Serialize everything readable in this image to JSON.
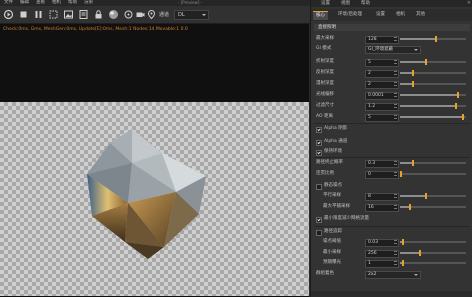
{
  "menu": {
    "items": [
      "文件",
      "编辑",
      "查看",
      "相机",
      "帮助",
      "渲染"
    ],
    "window_title": "- [Preview] -"
  },
  "toolbar": {
    "view_label": "通道",
    "view_value": "DL"
  },
  "viewport": {
    "stats": "Check:0ms, Gms, MeshGen:0ms, Update[E]:0ms, Mesh:1 Nodes:14 Movable:1 0.0"
  },
  "panel": {
    "menu": [
      "设置",
      "视图",
      "帮助"
    ],
    "tabs": [
      "核心",
      "环境/后处理",
      "设置",
      "相机",
      "其他"
    ],
    "active_tab": 0,
    "section_title": "直接照明",
    "rows": [
      {
        "kind": "slider",
        "label": "最大采样",
        "value": "128",
        "level": 0.55
      },
      {
        "kind": "select",
        "label": "GI 模式",
        "value": "GI_环境遮蔽"
      },
      {
        "kind": "slider",
        "label": "折射深度",
        "value": "5",
        "level": 0.4
      },
      {
        "kind": "slider",
        "label": "反射深度",
        "value": "2",
        "level": 0.2
      },
      {
        "kind": "slider",
        "label": "漫射深度",
        "value": "2",
        "level": 0.2
      },
      {
        "kind": "slider",
        "label": "光线偏移",
        "value": "0.0001",
        "level": 0.88
      },
      {
        "kind": "slider",
        "label": "过滤尺寸",
        "value": "1.2",
        "level": 0.85
      },
      {
        "kind": "slider",
        "label": "AO 距离",
        "value": "5",
        "level": 0.95
      },
      {
        "kind": "check",
        "label": "Alpha 阴影",
        "checked": true
      },
      {
        "kind": "check",
        "label": "Alpha 通道",
        "checked": true
      },
      {
        "kind": "check",
        "label": "保持环境",
        "checked": true
      },
      {
        "kind": "slider",
        "label": "路径终止概率",
        "value": "0.3",
        "level": 0.2
      },
      {
        "kind": "slider",
        "label": "连贯比例",
        "value": "0",
        "level": 0.0
      },
      {
        "kind": "check",
        "label": "静态噪点",
        "checked": false
      },
      {
        "kind": "slider",
        "label": "平行采样",
        "value": "8",
        "level": 0.4,
        "sub": true
      },
      {
        "kind": "slider",
        "label": "最大平铺采样",
        "value": "16",
        "level": 0.15,
        "sub": true
      },
      {
        "kind": "check",
        "label": "最小限度减少网格流量",
        "checked": true
      },
      {
        "kind": "check",
        "label": "路径追踪",
        "checked": false
      },
      {
        "kind": "slider",
        "label": "噪点阈值",
        "value": "0.03",
        "level": 0.05,
        "sub": true
      },
      {
        "kind": "slider",
        "label": "最小采样",
        "value": "256",
        "level": 0.3,
        "sub": true
      },
      {
        "kind": "slider",
        "label": "预期曝光",
        "value": "1",
        "level": 0.05,
        "sub": true
      },
      {
        "kind": "select",
        "label": "群组着色",
        "value": "2x2"
      }
    ]
  },
  "colors": {
    "accent": "#e8a22a",
    "stats_text": "#d27f2f",
    "panel_bg": "#333333",
    "viewport_bg": "#101010"
  },
  "icons": [
    "render-icon",
    "stop-icon",
    "pause-icon",
    "region-icon",
    "image-icon",
    "settings-icon",
    "lock-icon",
    "material-icon",
    "focus-icon",
    "camera-icon",
    "pick-icon"
  ]
}
